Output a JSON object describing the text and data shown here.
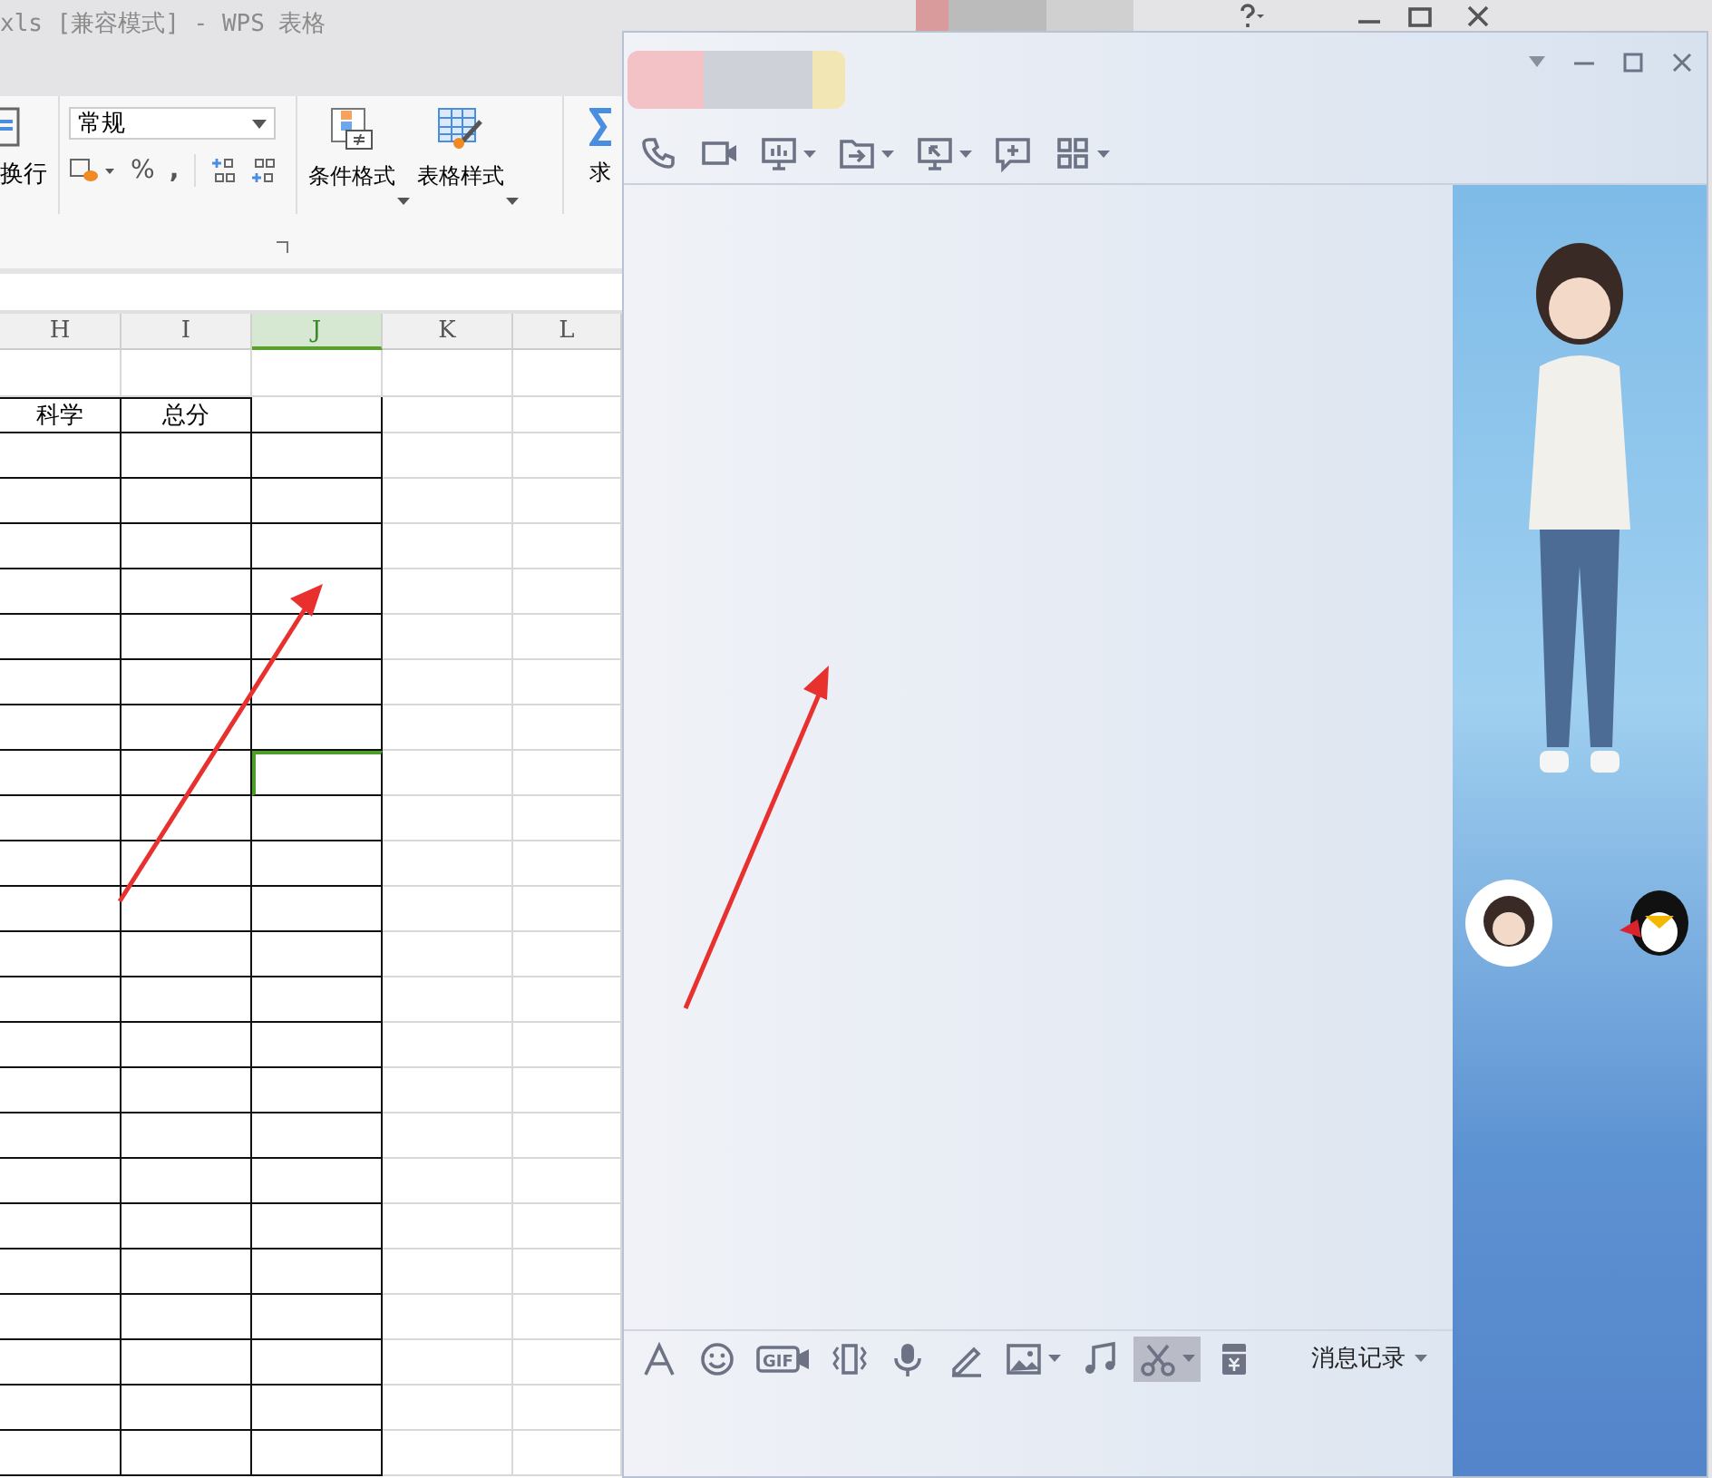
{
  "spreadsheet": {
    "title": "xls [兼容模式] - WPS 表格",
    "ribbon": {
      "wrap_label": "换行",
      "number_format": "常规",
      "percent": "%",
      "comma": ",",
      "buttons": [
        {
          "label": "条件格式",
          "kind": "conditional"
        },
        {
          "label": "表格样式",
          "kind": "table-style"
        }
      ],
      "sum_label": "求"
    },
    "columns": [
      {
        "label": "H",
        "selected": false
      },
      {
        "label": "I",
        "selected": false
      },
      {
        "label": "J",
        "selected": true
      },
      {
        "label": "K",
        "selected": false
      },
      {
        "label": "L",
        "selected": false
      }
    ],
    "header_cells": [
      "科学",
      "总分"
    ],
    "rows": [
      {
        "active_cell": false
      },
      {
        "active_cell": false
      },
      {
        "active_cell": false
      },
      {
        "active_cell": false
      },
      {
        "active_cell": false
      },
      {
        "active_cell": false
      },
      {
        "active_cell": false
      },
      {
        "active_cell": true
      },
      {
        "active_cell": false
      },
      {
        "active_cell": false
      },
      {
        "active_cell": false
      },
      {
        "active_cell": false
      },
      {
        "active_cell": false
      },
      {
        "active_cell": false
      },
      {
        "active_cell": false
      },
      {
        "active_cell": false
      },
      {
        "active_cell": false
      },
      {
        "active_cell": false
      },
      {
        "active_cell": false
      },
      {
        "active_cell": false
      },
      {
        "active_cell": false
      },
      {
        "active_cell": false
      },
      {
        "active_cell": false
      }
    ]
  },
  "chat_window": {
    "toolbar": [
      {
        "kind": "phone",
        "dropdown": false
      },
      {
        "kind": "video",
        "dropdown": false
      },
      {
        "kind": "screen",
        "dropdown": true
      },
      {
        "kind": "folder",
        "dropdown": true
      },
      {
        "kind": "remote",
        "dropdown": true
      },
      {
        "kind": "chat-plus",
        "dropdown": false
      },
      {
        "kind": "apps",
        "dropdown": true
      }
    ],
    "bottom_toolbar": [
      {
        "kind": "font",
        "dropdown": false,
        "highlighted": false
      },
      {
        "kind": "smiley",
        "dropdown": false,
        "highlighted": false
      },
      {
        "kind": "gif",
        "label": "GIF",
        "dropdown": false,
        "highlighted": false
      },
      {
        "kind": "shake",
        "dropdown": false,
        "highlighted": false
      },
      {
        "kind": "mic",
        "dropdown": false,
        "highlighted": false
      },
      {
        "kind": "pen",
        "dropdown": false,
        "highlighted": false
      },
      {
        "kind": "image",
        "dropdown": true,
        "highlighted": false
      },
      {
        "kind": "music",
        "dropdown": false,
        "highlighted": false
      },
      {
        "kind": "scissors",
        "dropdown": true,
        "highlighted": true
      },
      {
        "kind": "red-packet",
        "dropdown": false,
        "highlighted": false
      }
    ],
    "history_label": "消息记录"
  }
}
